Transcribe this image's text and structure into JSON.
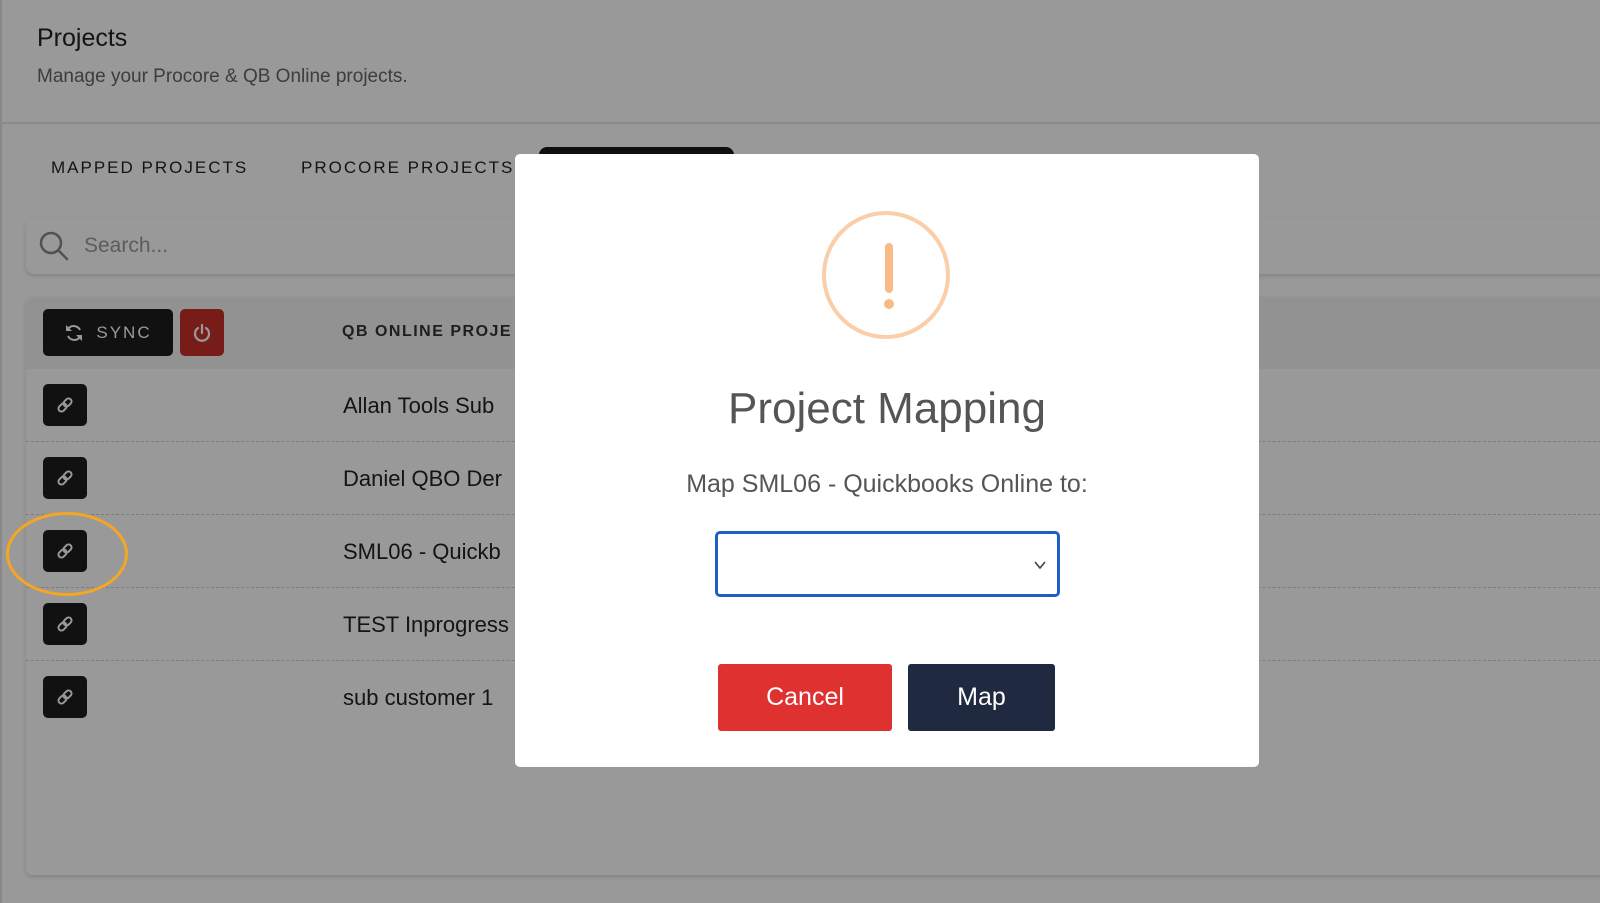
{
  "header": {
    "title": "Projects",
    "subtitle": "Manage your Procore & QB Online projects."
  },
  "tabs": [
    {
      "label": "MAPPED PROJECTS"
    },
    {
      "label": "PROCORE PROJECTS"
    }
  ],
  "search": {
    "placeholder": "Search...",
    "icon": "search-icon"
  },
  "table": {
    "sync_label": "SYNC",
    "column_header": "QB ONLINE PROJE",
    "rows": [
      {
        "name": "Allan Tools Sub"
      },
      {
        "name": "Daniel QBO Der"
      },
      {
        "name": "SML06 - Quickb"
      },
      {
        "name": "TEST Inprogress"
      },
      {
        "name": "sub customer 1"
      }
    ]
  },
  "modal": {
    "icon": "exclamation-icon",
    "title": "Project Mapping",
    "message": "Map SML06 - Quickbooks Online to:",
    "select_value": "",
    "cancel_label": "Cancel",
    "map_label": "Map"
  },
  "colors": {
    "cancel": "#e03131",
    "map": "#1f2a40",
    "warning": "#f8bb86",
    "annotation": "#f5a623",
    "power": "#c9302c"
  }
}
